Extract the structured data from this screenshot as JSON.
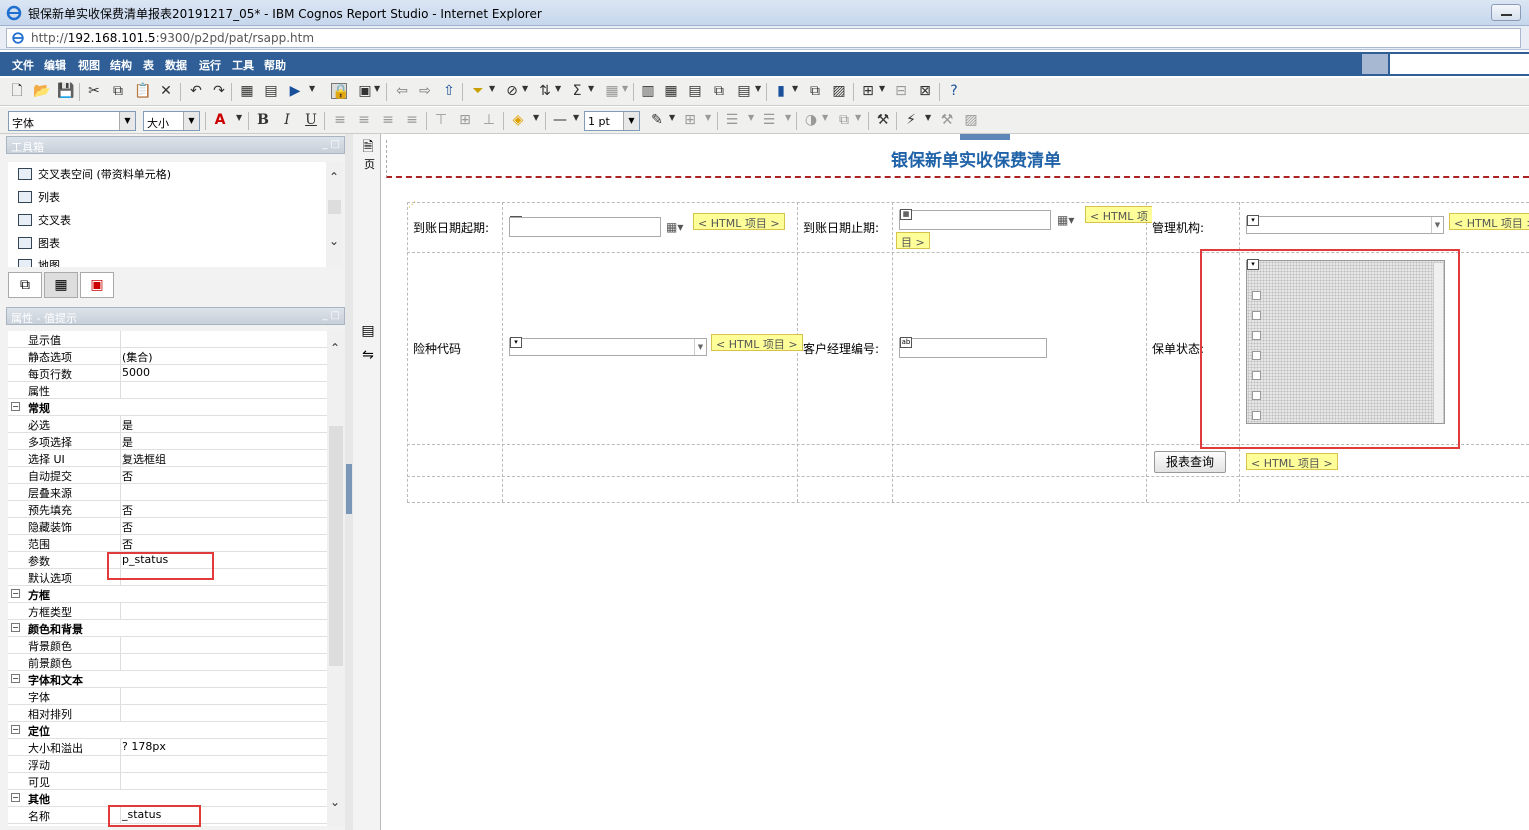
{
  "window": {
    "title": "银保新单实收保费清单报表20191217_05* - IBM Cognos Report Studio - Internet Explorer",
    "url_prefix": "http://",
    "url_host": "192.168.101.5",
    "url_rest": ":9300/p2pd/pat/rsapp.htm"
  },
  "menu": [
    "文件",
    "编辑",
    "视图",
    "结构",
    "表",
    "数据",
    "运行",
    "工具",
    "帮助"
  ],
  "format_toolbar": {
    "font_combo": "字体",
    "size_combo": "大小",
    "line_width_combo": "1 pt"
  },
  "toolbox": {
    "header": "工具箱",
    "items": [
      "交叉表空间 (带资料单元格)",
      "列表",
      "交叉表",
      "图表",
      "地图"
    ]
  },
  "properties": {
    "header": "属性 - ",
    "header_sub": "值提示",
    "rows": [
      {
        "name": "显示值",
        "value": "",
        "group": false
      },
      {
        "name": "静态选项",
        "value": "(集合)",
        "group": false
      },
      {
        "name": "每页行数",
        "value": "5000",
        "group": false
      },
      {
        "name": "属性",
        "value": "",
        "group": false
      },
      {
        "name": "常规",
        "value": "",
        "group": true
      },
      {
        "name": "必选",
        "value": "是",
        "group": false
      },
      {
        "name": "多项选择",
        "value": "是",
        "group": false
      },
      {
        "name": "选择 UI",
        "value": "复选框组",
        "group": false
      },
      {
        "name": "自动提交",
        "value": "否",
        "group": false
      },
      {
        "name": "层叠来源",
        "value": "",
        "group": false
      },
      {
        "name": "预先填充",
        "value": "否",
        "group": false
      },
      {
        "name": "隐藏装饰",
        "value": "否",
        "group": false
      },
      {
        "name": "范围",
        "value": "否",
        "group": false
      },
      {
        "name": "参数",
        "value": "p_status",
        "group": false
      },
      {
        "name": "默认选项",
        "value": "",
        "group": false
      },
      {
        "name": "方框",
        "value": "",
        "group": true
      },
      {
        "name": "方框类型",
        "value": "",
        "group": false
      },
      {
        "name": "颜色和背景",
        "value": "",
        "group": true
      },
      {
        "name": "背景颜色",
        "value": "",
        "group": false
      },
      {
        "name": "前景颜色",
        "value": "",
        "group": false
      },
      {
        "name": "字体和文本",
        "value": "",
        "group": true
      },
      {
        "name": "字体",
        "value": "",
        "group": false
      },
      {
        "name": "相对排列",
        "value": "",
        "group": false
      },
      {
        "name": "定位",
        "value": "",
        "group": true
      },
      {
        "name": "大小和溢出",
        "value": "?  178px",
        "group": false
      },
      {
        "name": "浮动",
        "value": "",
        "group": false
      },
      {
        "name": "可见",
        "value": "",
        "group": false
      },
      {
        "name": "其他",
        "value": "",
        "group": true
      },
      {
        "name": "名称",
        "value": "_status",
        "group": false
      }
    ]
  },
  "sidebar_label": "页",
  "report": {
    "title": "银保新单实收保费清单",
    "label_start_date": "到账日期起期:",
    "label_end_date": "到账日期止期:",
    "label_org": "管理机构:",
    "label_risk_code": "险种代码",
    "label_manager_no": "客户经理编号:",
    "label_status": "保单状态:",
    "html_item": "< HTML 项目 >",
    "html_item_cut": "< HTML 项",
    "html_item_cut2": "目 >",
    "query_button": "报表查询"
  },
  "colors": {
    "menu_bg": "#2f5f96",
    "title_color": "#1f62a8",
    "highlight_red": "#e03a3a"
  }
}
